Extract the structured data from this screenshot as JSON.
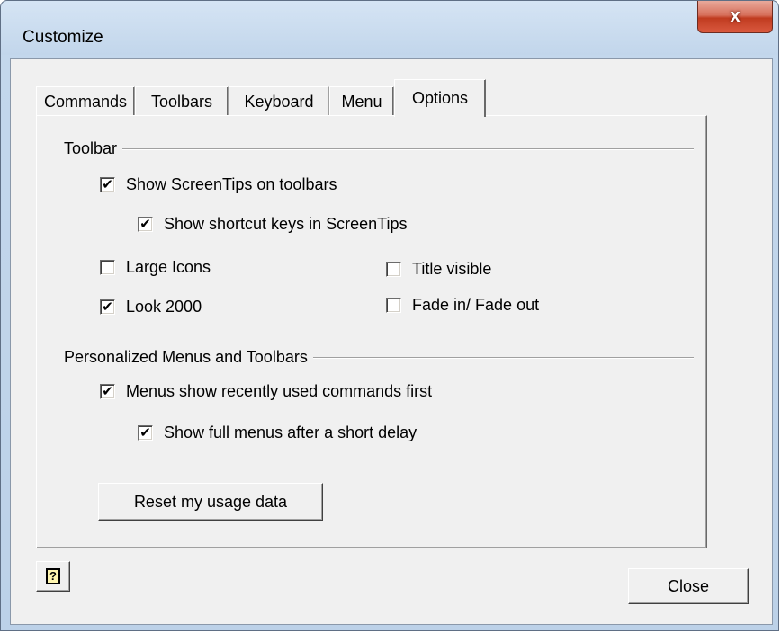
{
  "window": {
    "title": "Customize",
    "close_glyph": "x"
  },
  "tabs": [
    {
      "label": "Commands",
      "active": false
    },
    {
      "label": "Toolbars",
      "active": false
    },
    {
      "label": "Keyboard",
      "active": false
    },
    {
      "label": "Menu",
      "active": false
    },
    {
      "label": "Options",
      "active": true
    }
  ],
  "toolbar_group": {
    "label": "Toolbar",
    "show_screentips": {
      "label": "Show ScreenTips on toolbars",
      "checked": true
    },
    "show_shortcut_keys": {
      "label": "Show shortcut keys in ScreenTips",
      "checked": true
    },
    "large_icons": {
      "label": "Large Icons",
      "checked": false
    },
    "look_2000": {
      "label": "Look 2000",
      "checked": true
    },
    "title_visible": {
      "label": "Title visible",
      "checked": false
    },
    "fade": {
      "label": "Fade in/ Fade out",
      "checked": false
    }
  },
  "personalized_group": {
    "label": "Personalized Menus and Toolbars",
    "recent_first": {
      "label": "Menus show recently used commands first",
      "checked": true
    },
    "full_menus_delay": {
      "label": "Show full menus after a short delay",
      "checked": true
    },
    "reset_button": "Reset my usage data"
  },
  "footer": {
    "help_icon": "help-icon",
    "help_glyph": "?",
    "close_button": "Close"
  },
  "check_mark": "✔"
}
